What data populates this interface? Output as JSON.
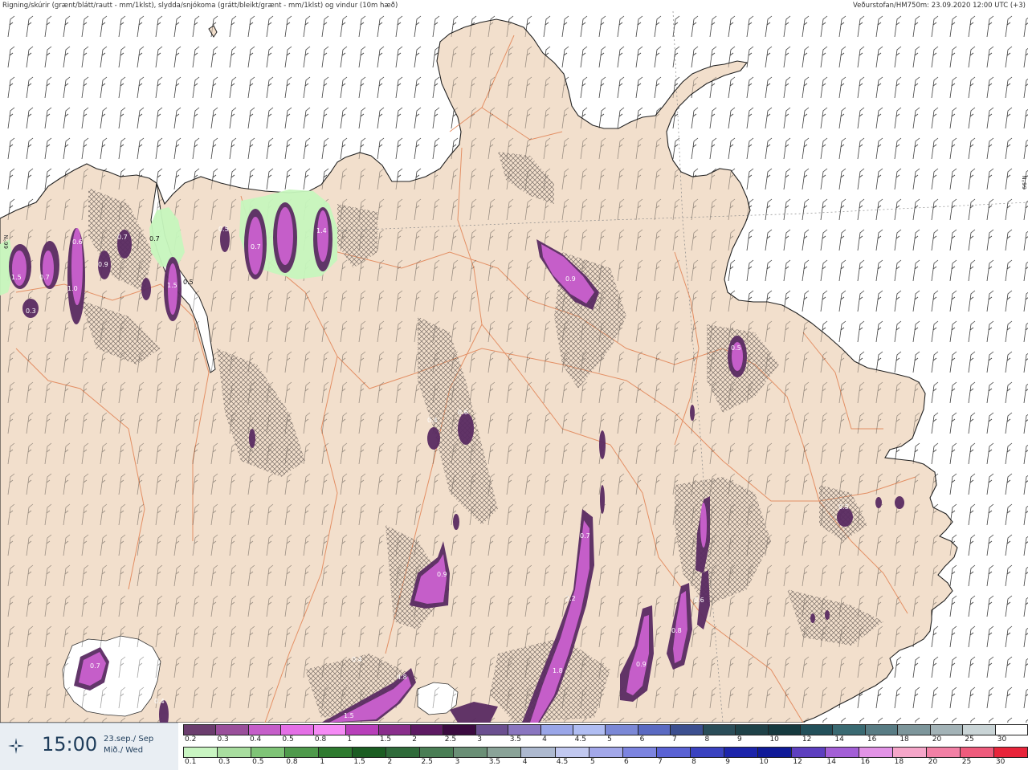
{
  "header": {
    "title_left": "Rigning/skúrir (grænt/blátt/rautt - mm/1klst), slydda/snjókoma (grátt/bleikt/grænt - mm/1klst) og vindur (10m hæð)",
    "title_right": "Veðurstofan/HM750m: 23.09.2020 12:00 UTC (+3)"
  },
  "map": {
    "colors": {
      "sea": "#ffffff",
      "land": "#f2dfcc",
      "coast": "#222222",
      "roads": "#e2875a",
      "snow_light": "#c58bd6",
      "snow_mid": "#a23fc0",
      "snow_dark": "#5a2b62",
      "rain_green": "#c6f5bd",
      "hatch": "#7a6f68"
    },
    "graticule_labels": [
      "66°N",
      "66°N"
    ],
    "precip_labels": [
      "1.5",
      "0.7",
      "0.3",
      "1.0",
      "0.9",
      "1.5",
      "0.7",
      "0.7",
      "0.6",
      "0.5",
      "1.4",
      "0.9",
      "0.5",
      "0.4",
      "0.6",
      "0.7",
      "0.9",
      "2.2",
      "1.8",
      "0.4",
      "4.8",
      "1.5",
      "0.9",
      "0.6",
      "0.8",
      "0.7",
      "0.4",
      "0.5"
    ],
    "contour_labels": [
      "0.7",
      "0.5"
    ]
  },
  "footer": {
    "time": "15:00",
    "date_line1": "23.sep./ Sep",
    "date_line2": "Mið./ Wed",
    "logo_icon": "vedurstofan-logo-icon",
    "rain_scale": {
      "labels": [
        "0.2",
        "0.3",
        "0.4",
        "0.5",
        "0.8",
        "1",
        "1.5",
        "2",
        "2.5",
        "3",
        "3.5",
        "4",
        "4.5",
        "5",
        "6",
        "7",
        "8",
        "9",
        "10",
        "12",
        "14",
        "16",
        "18",
        "20",
        "25",
        "30"
      ],
      "colors": [
        "#6b3d6e",
        "#9a4f9b",
        "#c55ec9",
        "#e46fe6",
        "#f58af5",
        "#b83fba",
        "#8a2e8c",
        "#5e1a63",
        "#3b0a40",
        "#6b4f90",
        "#8a76c0",
        "#9aa6e8",
        "#b0bdf2",
        "#7b88d6",
        "#5a6ac2",
        "#3c4f8f",
        "#2a4d58",
        "#1f4248",
        "#163a3f",
        "#23505a",
        "#3a6a72",
        "#587c84",
        "#7d969b",
        "#a3b3b7",
        "#c9d4d6",
        "#ffffff"
      ]
    },
    "snow_scale": {
      "labels": [
        "0.1",
        "0.3",
        "0.5",
        "0.8",
        "1",
        "1.5",
        "2",
        "2.5",
        "3",
        "3.5",
        "4",
        "4.5",
        "5",
        "6",
        "7",
        "8",
        "9",
        "10",
        "12",
        "14",
        "16",
        "18",
        "20",
        "25",
        "30"
      ],
      "colors": [
        "#c9f5c2",
        "#a8dd9f",
        "#7fc477",
        "#4f9a4c",
        "#2e7a2f",
        "#1b5d22",
        "#2f6b3a",
        "#4a7e55",
        "#6a8f76",
        "#8aa398",
        "#adb9cf",
        "#c1c8ef",
        "#a3a8ea",
        "#7c84e0",
        "#5a62d4",
        "#3a42c0",
        "#1c24aa",
        "#101a98",
        "#5d3fbf",
        "#a35fd6",
        "#e293e6",
        "#f5a6c9",
        "#f280a5",
        "#ee5b7c",
        "#e8243a"
      ]
    }
  }
}
